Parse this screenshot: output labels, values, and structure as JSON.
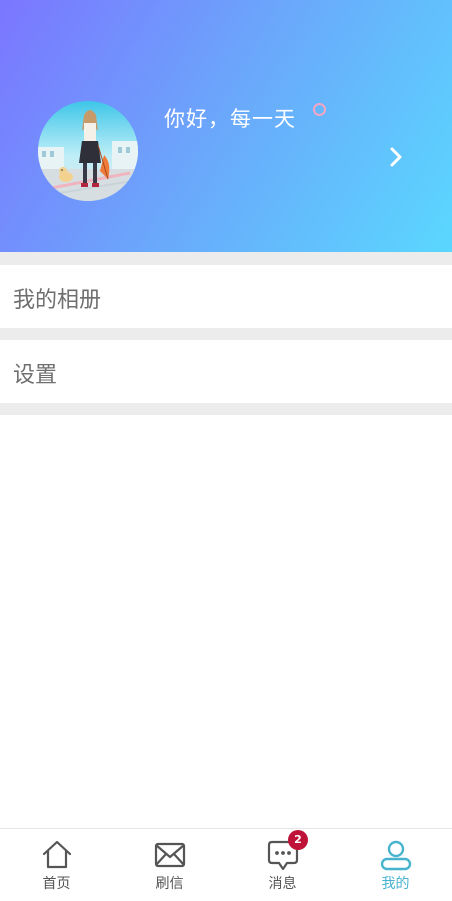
{
  "profile": {
    "greeting": "你好，每一天",
    "avatar_icon": "avatar-image",
    "chevron_icon": "chevron-right-icon",
    "colors": {
      "gradient_start": "#7b76ff",
      "gradient_end": "#5ad7fe",
      "status_dot": "#f2a6c6"
    }
  },
  "menu": {
    "items": [
      {
        "label": "我的相册"
      },
      {
        "label": "设置"
      }
    ]
  },
  "tabbar": {
    "tabs": [
      {
        "label": "首页",
        "icon": "home-icon"
      },
      {
        "label": "刷信",
        "icon": "mail-icon"
      },
      {
        "label": "消息",
        "icon": "message-icon",
        "badge": "2"
      },
      {
        "label": "我的",
        "icon": "user-icon",
        "active": true
      }
    ],
    "active_color": "#47b3cf",
    "badge_color": "#bf1238"
  }
}
